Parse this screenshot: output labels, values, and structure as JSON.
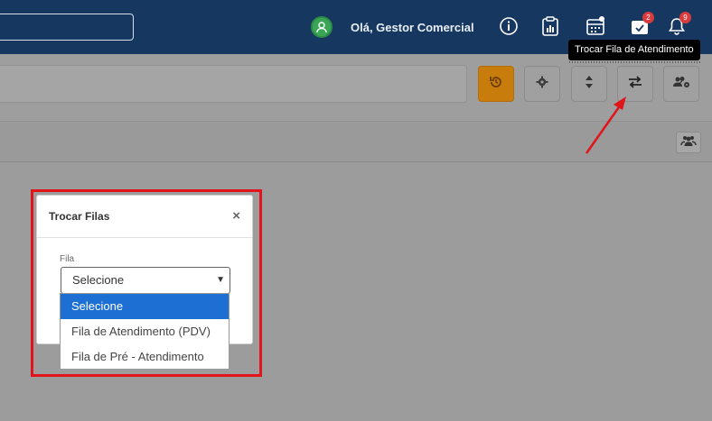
{
  "header": {
    "greeting": "Olá, Gestor Comercial",
    "icons": [
      "user-icon",
      "info-icon",
      "clipboard-chart-icon",
      "calendar-icon",
      "calendar-check-icon",
      "bell-icon"
    ],
    "badges": {
      "calendar_check": "2",
      "bell": "9"
    }
  },
  "toolbar": {
    "buttons": [
      "history-icon",
      "gear-icon",
      "sort-icon",
      "swap-icon",
      "users-gear-icon"
    ],
    "tooltip": "Trocar Fila de Atendimento"
  },
  "modal": {
    "title": "Trocar Filas",
    "close": "×",
    "field_label": "Fila",
    "selected": "Selecione",
    "options": [
      "Selecione",
      "Fila de Atendimento (PDV)",
      "Fila de Pré - Atendimento"
    ]
  },
  "colors": {
    "navbar": "#163760",
    "accent": "#c77c0b",
    "highlight": "#e0141a",
    "selected_option": "#1e6fd4"
  }
}
